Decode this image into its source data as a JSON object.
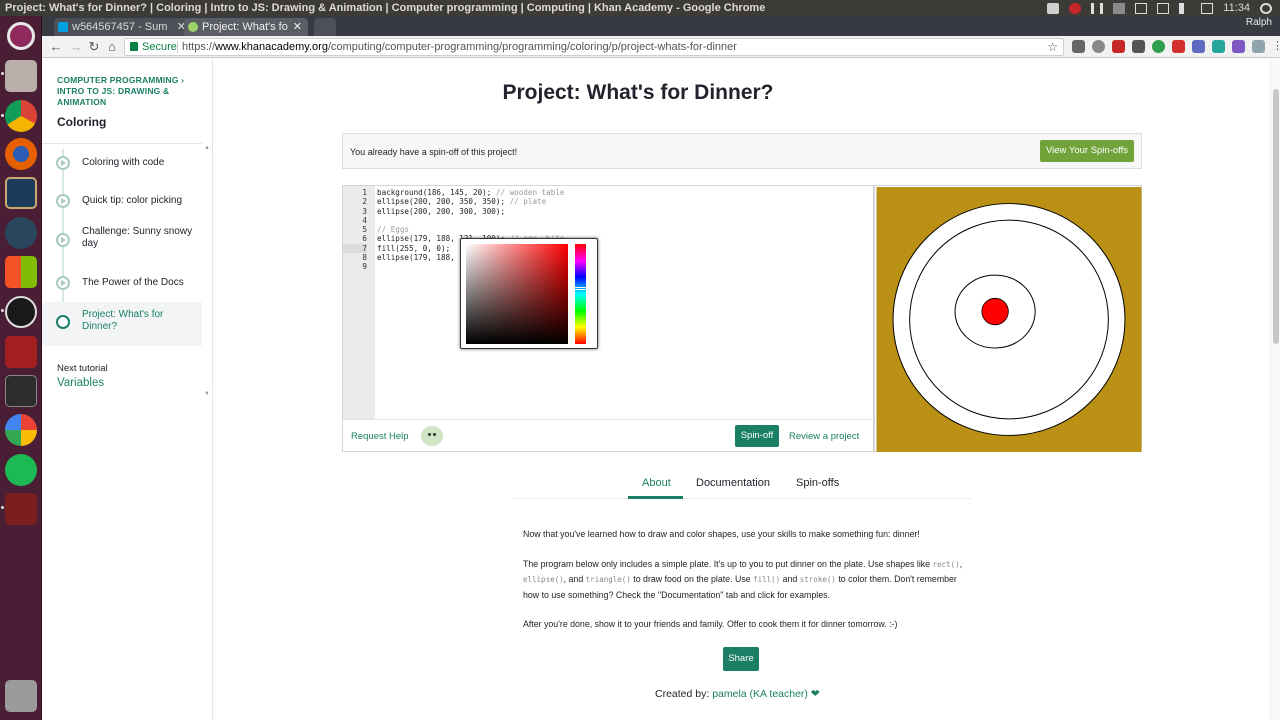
{
  "system": {
    "window_title": "Project: What's for Dinner? | Coloring | Intro to JS: Drawing & Animation | Computer programming | Computing | Khan Academy - Google Chrome",
    "clock": "11:34",
    "user": "Ralph"
  },
  "browser": {
    "tabs": [
      {
        "label": "w564567457 - Sum"
      },
      {
        "label": "Project: What's fo"
      }
    ],
    "secure_label": "Secure",
    "url_prefix": "https://",
    "url_host": "www.khanacademy.org",
    "url_path": "/computing/computer-programming/programming/coloring/p/project-whats-for-dinner"
  },
  "sidebar": {
    "breadcrumb_1": "COMPUTER PROGRAMMING",
    "breadcrumb_sep": "›",
    "breadcrumb_2": "INTRO TO JS: DRAWING & ANIMATION",
    "section": "Coloring",
    "items": [
      {
        "label": "Coloring with code"
      },
      {
        "label": "Quick tip: color picking"
      },
      {
        "label": "Challenge: Sunny snowy day"
      },
      {
        "label": "The Power of the Docs"
      },
      {
        "label": "Project: What's for Dinner?"
      }
    ],
    "next_label": "Next tutorial",
    "next_link": "Variables"
  },
  "main": {
    "title": "Project: What's for Dinner?",
    "notice": "You already have a spin-off of this project!",
    "view_spinoffs": "View Your Spin-offs",
    "code_lines": [
      {
        "num": "1",
        "code": "background(186, 145, 20); ",
        "comment": "// wooden table"
      },
      {
        "num": "2",
        "code": "ellipse(200, 200, 350, 350); ",
        "comment": "// plate"
      },
      {
        "num": "3",
        "code": "ellipse(200, 200, 300, 300);",
        "comment": ""
      },
      {
        "num": "4",
        "code": "",
        "comment": ""
      },
      {
        "num": "5",
        "code": "",
        "comment": "// Eggs"
      },
      {
        "num": "6",
        "code": "ellipse(179, 188, 121, 100); ",
        "comment": "// egg white"
      },
      {
        "num": "7",
        "code": "fill(255, 0, 0);",
        "comment": ""
      },
      {
        "num": "8",
        "code": "ellipse(179, 188, ",
        "comment": ""
      },
      {
        "num": "9",
        "code": "",
        "comment": ""
      }
    ],
    "request_help": "Request Help",
    "spinoff": "Spin-off",
    "review": "Review a project",
    "tabs": [
      {
        "label": "About"
      },
      {
        "label": "Documentation"
      },
      {
        "label": "Spin-offs"
      }
    ],
    "about": {
      "p1": "Now that you've learned how to draw and color shapes, use your skills to make something fun: dinner!",
      "p2a": "The program below only includes a simple plate. It's up to you to put dinner on the plate. Use shapes like",
      "rect": "rect()",
      "comma": ",",
      "ellipse": "ellipse()",
      "and": ", and",
      "triangle": "triangle()",
      "p2b": " to draw food on the plate. Use",
      "fill": "fill()",
      "and2": " and",
      "stroke": "stroke()",
      "p2c": " to color them. Don't remember how to use something? Check the \"Documentation\" tab and click for examples.",
      "p3": "After you're done, show it to your friends and family. Offer to cook them it for dinner tomorrow. :-)"
    },
    "share": "Share",
    "created_by": "Created by:",
    "author": "pamela (KA teacher)",
    "heart": "❤"
  },
  "colors": {
    "ka_green": "#1a7f64",
    "spinoff_green": "#72a33a",
    "table_color": "#ba9114",
    "egg_yolk": "#ff0000"
  }
}
